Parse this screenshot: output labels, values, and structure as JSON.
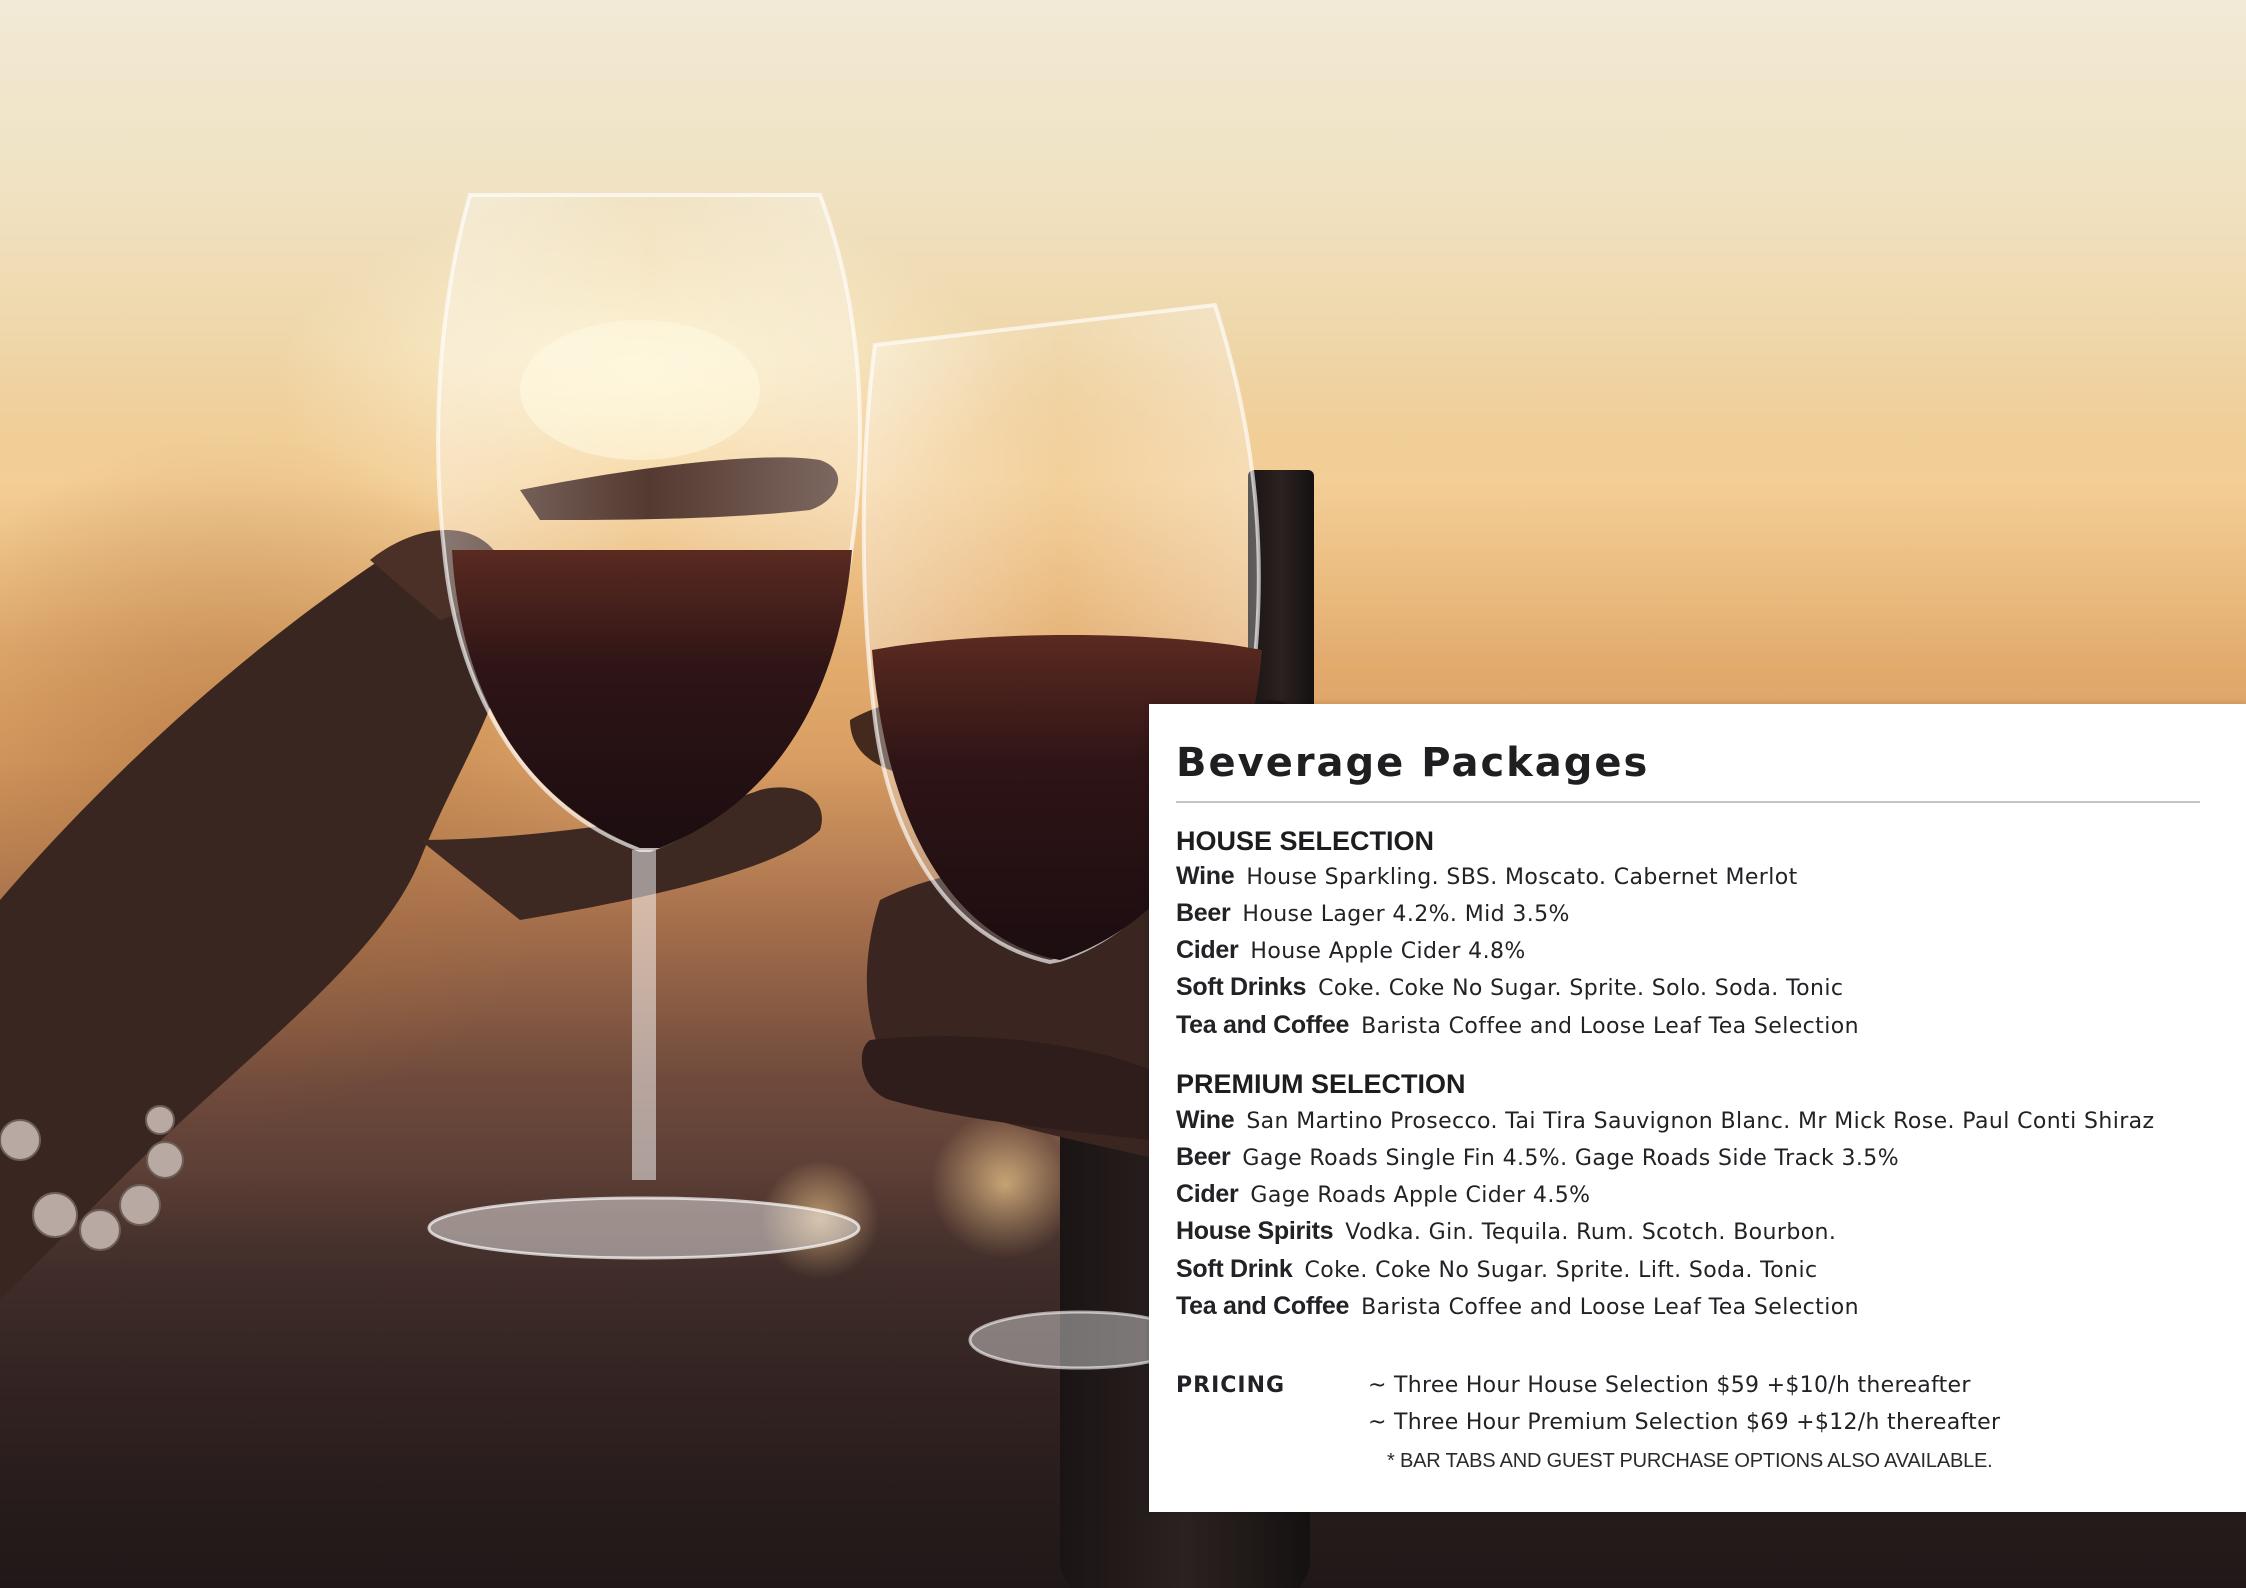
{
  "title": "Beverage Packages",
  "house_selection": {
    "heading": "HOUSE SELECTION",
    "items": [
      {
        "label": "Wine",
        "description": "House Sparkling. SBS. Moscato. Cabernet Merlot"
      },
      {
        "label": "Beer",
        "description": "House Lager 4.2%. Mid 3.5%"
      },
      {
        "label": "Cider",
        "description": "House Apple Cider 4.8%"
      },
      {
        "label": "Soft Drinks",
        "description": "Coke. Coke No Sugar. Sprite. Solo. Soda. Tonic"
      },
      {
        "label": "Tea and Coffee",
        "description": "Barista Coffee and Loose Leaf Tea Selection"
      }
    ]
  },
  "premium_selection": {
    "heading": "PREMIUM SELECTION",
    "items": [
      {
        "label": "Wine",
        "description": "San Martino Prosecco. Tai Tira Sauvignon Blanc. Mr Mick Rose. Paul Conti Shiraz"
      },
      {
        "label": "Beer",
        "description": "Gage Roads Single Fin 4.5%. Gage Roads Side Track 3.5%"
      },
      {
        "label": "Cider",
        "description": "Gage Roads Apple Cider 4.5%"
      },
      {
        "label": "House Spirits",
        "description": "Vodka. Gin. Tequila. Rum. Scotch. Bourbon."
      },
      {
        "label": "Soft Drink",
        "description": "Coke. Coke No Sugar. Sprite. Lift. Soda. Tonic"
      },
      {
        "label": "Tea and Coffee",
        "description": "Barista Coffee and Loose Leaf Tea Selection"
      }
    ]
  },
  "pricing": {
    "label": "PRICING",
    "lines": [
      "~ Three Hour House Selection $59 +$10/h thereafter",
      "~ Three Hour Premium Selection $69 +$12/h thereafter"
    ],
    "note": "* BAR TABS AND GUEST PURCHASE OPTIONS ALSO AVAILABLE."
  },
  "colors": {
    "card_background": "#ffffff",
    "text": "#1f1f22",
    "rule": "#c4c4c4",
    "wine": "#3a1a1c"
  },
  "background_image": {
    "subject": "wine-glasses-toast-photo"
  }
}
